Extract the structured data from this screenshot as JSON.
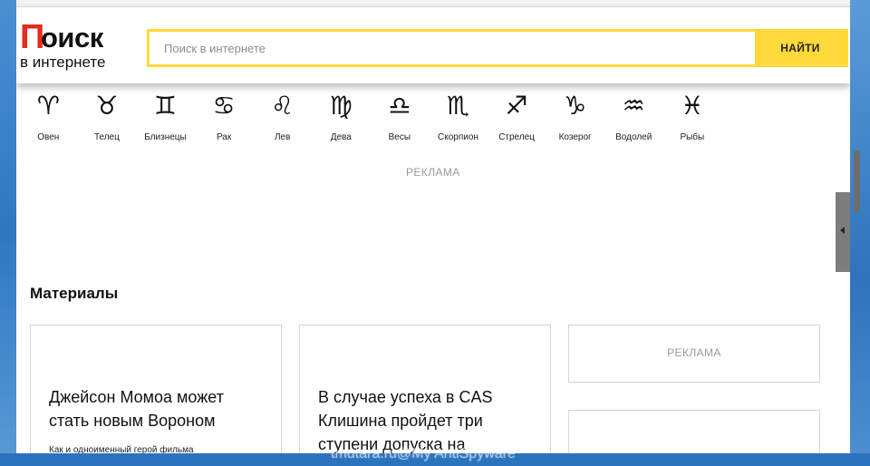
{
  "header": {
    "logo_first_letter": "П",
    "logo_rest": "оиск",
    "logo_subtitle": "в интернете",
    "search_placeholder": "Поиск в интернете",
    "search_value": "",
    "search_button": "НАЙТИ",
    "accent_color": "#ffd93a",
    "logo_color": "#e52b1e"
  },
  "zodiac": [
    {
      "glyph": "♈",
      "label": "Овен"
    },
    {
      "glyph": "♉",
      "label": "Телец"
    },
    {
      "glyph": "♊",
      "label": "Близнецы"
    },
    {
      "glyph": "♋",
      "label": "Рак"
    },
    {
      "glyph": "♌",
      "label": "Лев"
    },
    {
      "glyph": "♍",
      "label": "Дева"
    },
    {
      "glyph": "♎",
      "label": "Весы"
    },
    {
      "glyph": "♏",
      "label": "Скорпион"
    },
    {
      "glyph": "♐",
      "label": "Стрелец"
    },
    {
      "glyph": "♑",
      "label": "Козерог"
    },
    {
      "glyph": "♒",
      "label": "Водолей"
    },
    {
      "glyph": "♓",
      "label": "Рыбы"
    }
  ],
  "ads": {
    "top_label": "РЕКЛАМА",
    "side_label": "РЕКЛАМА"
  },
  "materials": {
    "title": "Материалы",
    "cards": [
      {
        "title": "Джейсон Момоа может стать новым Вороном",
        "subtitle": "Как и одноименный герой фильма"
      },
      {
        "title": "В случае успеха в CAS Клишина пройдет три ступени допуска на",
        "subtitle": ""
      }
    ]
  },
  "watermark": "tmutara.ru@My AntiSpyware"
}
